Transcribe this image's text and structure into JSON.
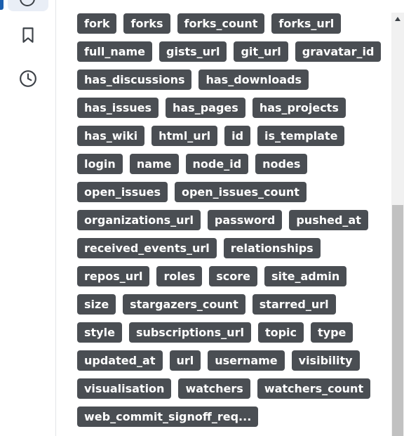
{
  "sidebar": {
    "items": [
      {
        "name": "active-nav-icon"
      },
      {
        "name": "bookmark-icon"
      },
      {
        "name": "history-clock-icon"
      }
    ]
  },
  "tags": [
    "fork",
    "forks",
    "forks_count",
    "forks_url",
    "full_name",
    "gists_url",
    "git_url",
    "gravatar_id",
    "has_discussions",
    "has_downloads",
    "has_issues",
    "has_pages",
    "has_projects",
    "has_wiki",
    "html_url",
    "id",
    "is_template",
    "login",
    "name",
    "node_id",
    "nodes",
    "open_issues",
    "open_issues_count",
    "organizations_url",
    "password",
    "pushed_at",
    "received_events_url",
    "relationships",
    "repos_url",
    "roles",
    "score",
    "site_admin",
    "size",
    "stargazers_count",
    "starred_url",
    "style",
    "subscriptions_url",
    "topic",
    "type",
    "updated_at",
    "url",
    "username",
    "visibility",
    "visualisation",
    "watchers",
    "watchers_count",
    "web_commit_signoff_req..."
  ],
  "colors": {
    "tag_background": "#4a4e53",
    "tag_text": "#ffffff",
    "active_indicator": "#1c5fae"
  }
}
